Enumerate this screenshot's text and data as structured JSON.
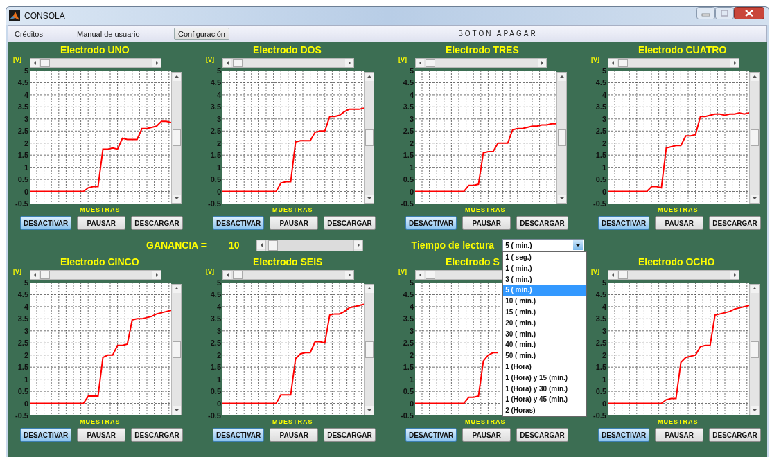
{
  "window": {
    "title": "CONSOLA"
  },
  "menu": [
    {
      "label": "Créditos",
      "kind": "menu"
    },
    {
      "label": "Manual de usuario",
      "kind": "menu"
    },
    {
      "label": "Configuración",
      "kind": "button"
    },
    {
      "label": "BOTON APAGAR",
      "kind": "wide"
    }
  ],
  "panels": [
    {
      "title": "Electrodo UNO",
      "buttons": [
        {
          "label": "DESACTIVAR",
          "highlighted": true
        },
        {
          "label": "PAUSAR",
          "highlighted": false
        },
        {
          "label": "DESCARGAR",
          "highlighted": false
        }
      ],
      "chart_data": {
        "type": "line",
        "xlabel": "MUESTRAS",
        "ylabel": "[V]",
        "ylim": [
          -0.5,
          5
        ],
        "yticks": [
          5,
          {
            "value": 4.5,
            "label": "4.5"
          },
          4,
          {
            "value": 3.5,
            "label": "3.5"
          },
          3,
          {
            "value": 2.5,
            "label": "2.5"
          },
          2,
          {
            "value": 1.5,
            "label": "1.5"
          },
          1,
          {
            "value": 0.5,
            "label": "0.5"
          },
          0,
          {
            "value": -0.5,
            "label": "-0.5"
          }
        ],
        "grid": true,
        "series": [
          {
            "color": "#ff0000",
            "values": [
              0,
              0,
              0,
              0,
              0,
              0,
              0,
              0,
              0,
              0,
              0,
              0,
              0.15,
              0.2,
              0.2,
              1.75,
              1.75,
              1.8,
              1.75,
              2.2,
              2.15,
              2.15,
              2.15,
              2.6,
              2.6,
              2.65,
              2.7,
              2.9,
              2.9,
              2.85
            ]
          }
        ]
      }
    },
    {
      "title": "Electrodo DOS",
      "buttons": [
        {
          "label": "DESACTIVAR",
          "highlighted": true
        },
        {
          "label": "PAUSAR",
          "highlighted": false
        },
        {
          "label": "DESCARGAR",
          "highlighted": false
        }
      ],
      "chart_data": {
        "type": "line",
        "xlabel": "MUESTRAS",
        "ylabel": "[V]",
        "ylim": [
          -0.5,
          5
        ],
        "yticks": [
          5,
          {
            "value": 4.5,
            "label": "4.5"
          },
          4,
          {
            "value": 3.5,
            "label": "3.5"
          },
          3,
          {
            "value": 2.5,
            "label": "2.5"
          },
          2,
          {
            "value": 1.5,
            "label": "1.5"
          },
          1,
          {
            "value": 0.5,
            "label": "0.5"
          },
          0,
          {
            "value": -0.5,
            "label": "-0.5"
          }
        ],
        "grid": true,
        "series": [
          {
            "color": "#ff0000",
            "values": [
              0,
              0,
              0,
              0,
              0,
              0,
              0,
              0,
              0,
              0,
              0,
              0,
              0.35,
              0.4,
              0.4,
              2.05,
              2.1,
              2.1,
              2.1,
              2.45,
              2.5,
              2.5,
              3.1,
              3.1,
              3.15,
              3.3,
              3.4,
              3.4,
              3.4,
              3.45
            ]
          }
        ]
      }
    },
    {
      "title": "Electrodo TRES",
      "buttons": [
        {
          "label": "DESACTIVAR",
          "highlighted": true
        },
        {
          "label": "PAUSAR",
          "highlighted": false
        },
        {
          "label": "DESCARGAR",
          "highlighted": false
        }
      ],
      "chart_data": {
        "type": "line",
        "xlabel": "MUESTRAS",
        "ylabel": "[V]",
        "ylim": [
          -0.5,
          5
        ],
        "yticks": [
          5,
          {
            "value": 4.5,
            "label": "4.5"
          },
          4,
          {
            "value": 3.5,
            "label": "3.5"
          },
          3,
          {
            "value": 2.5,
            "label": "2.5"
          },
          2,
          {
            "value": 1.5,
            "label": "1.5"
          },
          1,
          {
            "value": 0.5,
            "label": "0.5"
          },
          0,
          {
            "value": -0.5,
            "label": "-0.5"
          }
        ],
        "grid": true,
        "series": [
          {
            "color": "#ff0000",
            "values": [
              0,
              0,
              0,
              0,
              0,
              0,
              0,
              0,
              0,
              0,
              0,
              0.25,
              0.25,
              0.3,
              1.6,
              1.65,
              1.65,
              2.0,
              2.0,
              2.0,
              2.55,
              2.6,
              2.6,
              2.65,
              2.7,
              2.7,
              2.75,
              2.75,
              2.8,
              2.8
            ]
          }
        ]
      }
    },
    {
      "title": "Electrodo CUATRO",
      "buttons": [
        {
          "label": "DESACTIVAR",
          "highlighted": true
        },
        {
          "label": "PAUSAR",
          "highlighted": false
        },
        {
          "label": "DESCARGAR",
          "highlighted": false
        }
      ],
      "chart_data": {
        "type": "line",
        "xlabel": "MUESTRAS",
        "ylabel": "[V]",
        "ylim": [
          -0.5,
          5
        ],
        "yticks": [
          5,
          {
            "value": 4.5,
            "label": "4.5"
          },
          4,
          {
            "value": 3.5,
            "label": "3.5"
          },
          3,
          {
            "value": 2.5,
            "label": "2.5"
          },
          2,
          {
            "value": 1.5,
            "label": "1.5"
          },
          1,
          {
            "value": 0.5,
            "label": "0.5"
          },
          0,
          {
            "value": -0.5,
            "label": "-0.5"
          }
        ],
        "grid": true,
        "series": [
          {
            "color": "#ff0000",
            "values": [
              0,
              0,
              0,
              0,
              0,
              0,
              0,
              0,
              0,
              0.2,
              0.2,
              0.15,
              1.8,
              1.85,
              1.9,
              1.9,
              2.3,
              2.3,
              2.35,
              3.1,
              3.1,
              3.15,
              3.2,
              3.2,
              3.15,
              3.2,
              3.2,
              3.25,
              3.2,
              3.25
            ]
          }
        ]
      }
    }
  ],
  "controls": {
    "gain_label": "GANANCIA =",
    "gain_value": "10",
    "gain_slider": {
      "level": 0.03
    },
    "time_label": "Tiempo de lectura",
    "time_select": {
      "value": "5 ( min.)",
      "expanded": true,
      "options": [
        {
          "label": "1 ( seg.)",
          "selected": false
        },
        {
          "label": "1 ( min.)",
          "selected": false
        },
        {
          "label": "3 ( min.)",
          "selected": false
        },
        {
          "label": "5 ( min.)",
          "selected": true
        },
        {
          "label": "10 ( min.)",
          "selected": false
        },
        {
          "label": "15 ( min.)",
          "selected": false
        },
        {
          "label": "20 ( min.)",
          "selected": false
        },
        {
          "label": "30 ( min.)",
          "selected": false
        },
        {
          "label": "40 ( min.)",
          "selected": false
        },
        {
          "label": "50 ( min.)",
          "selected": false
        },
        {
          "label": "1 (Hora)",
          "selected": false
        },
        {
          "label": "1 (Hora) y 15 (min.)",
          "selected": false
        },
        {
          "label": "1 (Hora) y 30 (min.)",
          "selected": false
        },
        {
          "label": "1 (Hora) y 45 (min.)",
          "selected": false
        },
        {
          "label": "2 (Horas)",
          "selected": false
        }
      ]
    }
  },
  "panels_bottom": [
    {
      "title": "Electrodo CINCO",
      "buttons": [
        {
          "label": "DESACTIVAR",
          "highlighted": true
        },
        {
          "label": "PAUSAR",
          "highlighted": false
        },
        {
          "label": "DESCARGAR",
          "highlighted": false
        }
      ],
      "chart_data": {
        "type": "line",
        "xlabel": "MUESTRAS",
        "ylabel": "[V]",
        "ylim": [
          -0.5,
          5
        ],
        "yticks": [
          5,
          {
            "value": 4.5,
            "label": "4.5"
          },
          4,
          {
            "value": 3.5,
            "label": "3.5"
          },
          3,
          {
            "value": 2.5,
            "label": "2.5"
          },
          2,
          {
            "value": 1.5,
            "label": "1.5"
          },
          1,
          {
            "value": 0.5,
            "label": "0.5"
          },
          0,
          {
            "value": -0.5,
            "label": "-0.5"
          }
        ],
        "grid": true,
        "series": [
          {
            "color": "#ff0000",
            "values": [
              0,
              0,
              0,
              0,
              0,
              0,
              0,
              0,
              0,
              0,
              0,
              0,
              0.3,
              0.3,
              0.3,
              1.9,
              2.0,
              2.0,
              2.4,
              2.4,
              2.45,
              3.45,
              3.5,
              3.5,
              3.55,
              3.6,
              3.7,
              3.75,
              3.8,
              3.85
            ]
          }
        ]
      }
    },
    {
      "title": "Electrodo SEIS",
      "buttons": [
        {
          "label": "DESACTIVAR",
          "highlighted": true
        },
        {
          "label": "PAUSAR",
          "highlighted": false
        },
        {
          "label": "DESCARGAR",
          "highlighted": false
        }
      ],
      "chart_data": {
        "type": "line",
        "xlabel": "MUESTRAS",
        "ylabel": "[V]",
        "ylim": [
          -0.5,
          5
        ],
        "yticks": [
          5,
          {
            "value": 4.5,
            "label": "4.5"
          },
          4,
          {
            "value": 3.5,
            "label": "3.5"
          },
          3,
          {
            "value": 2.5,
            "label": "2.5"
          },
          2,
          {
            "value": 1.5,
            "label": "1.5"
          },
          1,
          {
            "value": 0.5,
            "label": "0.5"
          },
          0,
          {
            "value": -0.5,
            "label": "-0.5"
          }
        ],
        "grid": true,
        "series": [
          {
            "color": "#ff0000",
            "values": [
              0,
              0,
              0,
              0,
              0,
              0,
              0,
              0,
              0,
              0,
              0,
              0,
              0.35,
              0.35,
              0.35,
              1.85,
              2.05,
              2.1,
              2.1,
              2.55,
              2.55,
              2.5,
              3.65,
              3.7,
              3.7,
              3.8,
              3.95,
              4.0,
              4.05,
              4.1
            ]
          }
        ]
      }
    },
    {
      "title": "Electrodo S",
      "buttons": [
        {
          "label": "DESACTIVAR",
          "highlighted": true
        },
        {
          "label": "PAUSAR",
          "highlighted": false
        },
        {
          "label": "DESCARGAR",
          "highlighted": false
        }
      ],
      "chart_data": {
        "type": "line",
        "xlabel": "MUESTRAS",
        "ylabel": "[V]",
        "ylim": [
          -0.5,
          5
        ],
        "yticks": [
          5,
          {
            "value": 4.5,
            "label": "4.5"
          },
          4,
          {
            "value": 3.5,
            "label": "3.5"
          },
          3,
          {
            "value": 2.5,
            "label": "2.5"
          },
          2,
          {
            "value": 1.5,
            "label": "1.5"
          },
          1,
          {
            "value": 0.5,
            "label": "0.5"
          },
          0,
          {
            "value": -0.5,
            "label": "-0.5"
          }
        ],
        "grid": true,
        "series": [
          {
            "color": "#ff0000",
            "values": [
              0,
              0,
              0,
              0,
              0,
              0,
              0,
              0,
              0,
              0,
              0,
              0.25,
              0.25,
              0.3,
              1.75,
              2.0,
              2.1,
              2.1,
              null,
              null,
              null,
              null,
              null,
              null,
              null,
              null,
              null,
              null,
              null,
              null
            ]
          }
        ]
      }
    },
    {
      "title": "Electrodo OCHO",
      "buttons": [
        {
          "label": "DESACTIVAR",
          "highlighted": true
        },
        {
          "label": "PAUSAR",
          "highlighted": false
        },
        {
          "label": "DESCARGAR",
          "highlighted": false
        }
      ],
      "chart_data": {
        "type": "line",
        "xlabel": "MUESTRAS",
        "ylabel": "[V]",
        "ylim": [
          -0.5,
          5
        ],
        "yticks": [
          5,
          {
            "value": 4.5,
            "label": "4.5"
          },
          4,
          {
            "value": 3.5,
            "label": "3.5"
          },
          3,
          {
            "value": 2.5,
            "label": "2.5"
          },
          2,
          {
            "value": 1.5,
            "label": "1.5"
          },
          1,
          {
            "value": 0.5,
            "label": "0.5"
          },
          0,
          {
            "value": -0.5,
            "label": "-0.5"
          }
        ],
        "grid": true,
        "series": [
          {
            "color": "#ff0000",
            "values": [
              0,
              0,
              0,
              0,
              0,
              0,
              0,
              0,
              0,
              0,
              0,
              0,
              0.15,
              0.2,
              0.2,
              1.7,
              1.9,
              1.95,
              2.0,
              2.35,
              2.4,
              2.4,
              3.65,
              3.7,
              3.75,
              3.8,
              3.9,
              3.95,
              4.0,
              4.05
            ]
          }
        ]
      }
    }
  ]
}
